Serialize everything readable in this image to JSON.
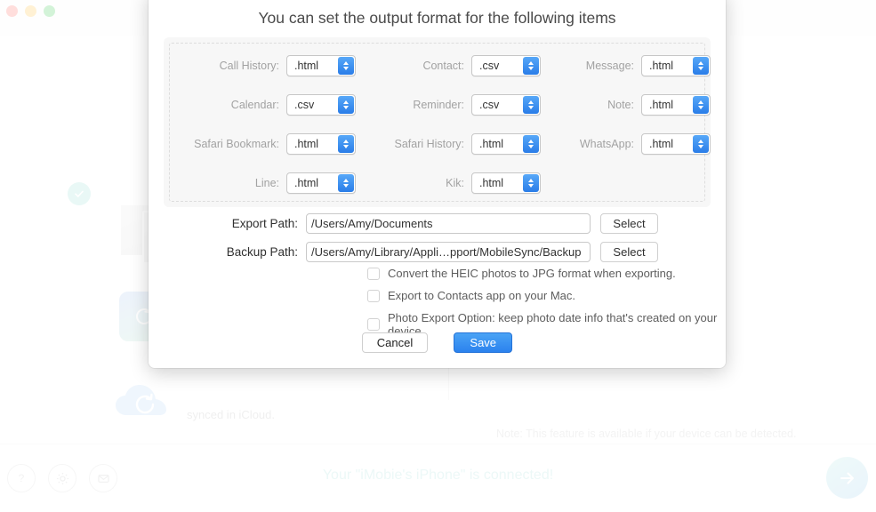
{
  "window": {
    "traffic_lights": [
      "close",
      "minimize",
      "zoom"
    ]
  },
  "background": {
    "caption": "synced in iCloud.",
    "note": "Note: This feature is available if your device can be detected."
  },
  "bottom_bar": {
    "icons": [
      {
        "name": "help-icon",
        "glyph": "?"
      },
      {
        "name": "settings-gear-icon",
        "glyph": "gear"
      },
      {
        "name": "feedback-mail-icon",
        "glyph": "envelope"
      }
    ],
    "status": "Your \"iMobie's iPhone\" is connected!",
    "next_button": "next-arrow"
  },
  "modal": {
    "title": "You can set the output format for the following items",
    "format_rows": [
      [
        {
          "label": "Call History:",
          "value": ".html"
        },
        {
          "label": "Contact:",
          "value": ".csv"
        },
        {
          "label": "Message:",
          "value": ".html"
        }
      ],
      [
        {
          "label": "Calendar:",
          "value": ".csv"
        },
        {
          "label": "Reminder:",
          "value": ".csv"
        },
        {
          "label": "Note:",
          "value": ".html"
        }
      ],
      [
        {
          "label": "Safari Bookmark:",
          "value": ".html"
        },
        {
          "label": "Safari History:",
          "value": ".html"
        },
        {
          "label": "WhatsApp:",
          "value": ".html"
        }
      ],
      [
        {
          "label": "Line:",
          "value": ".html"
        },
        {
          "label": "Kik:",
          "value": ".html"
        },
        {
          "label": "",
          "value": ""
        }
      ]
    ],
    "paths": [
      {
        "label": "Export Path:",
        "value": "/Users/Amy/Documents",
        "button": "Select"
      },
      {
        "label": "Backup Path:",
        "value": "/Users/Amy/Library/Appli…pport/MobileSync/Backup",
        "button": "Select"
      }
    ],
    "checkboxes": [
      {
        "label": "Convert the HEIC photos to JPG format when exporting.",
        "checked": false
      },
      {
        "label": "Export to Contacts app on your Mac.",
        "checked": false
      },
      {
        "label": "Photo Export Option: keep photo date info that's created on your device.",
        "checked": false
      }
    ],
    "footer": {
      "cancel_label": "Cancel",
      "save_label": "Save"
    }
  },
  "colors": {
    "accent_blue": "#2b82ee",
    "stepper_blue": "#2a7de8",
    "status_teal": "#d5efee",
    "modal_bg": "#ffffff",
    "group_bg": "#f7f7f7"
  }
}
